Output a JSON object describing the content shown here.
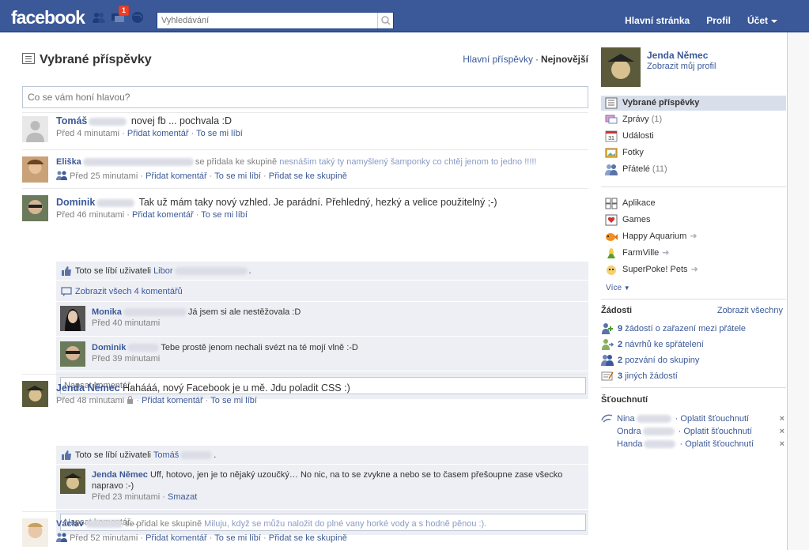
{
  "topbar": {
    "logo": "facebook",
    "notification_count": "1",
    "search_placeholder": "Vyhledávání",
    "nav": [
      "Hlavní stránka",
      "Profil",
      "Účet"
    ]
  },
  "header": {
    "title": "Vybrané příspěvky",
    "sort_top": "Hlavní příspěvky",
    "sort_recent": "Nejnovější"
  },
  "composer": {
    "placeholder": "Co se vám honí hlavou?"
  },
  "stories": [
    {
      "actor": "Tomáš",
      "text": "novej fb ... pochvala :D",
      "time": "Před 4 minutami",
      "comment": "Přidat komentář",
      "like": "To se mi líbí"
    },
    {
      "actor": "Eliška",
      "text": "se přidala ke skupině",
      "group": "nesnášim taký ty namyšlený šamponky co chtěj jenom to jedno !!!!!",
      "time": "Před 25 minutami",
      "comment": "Přidat komentář",
      "like": "To se mi líbí",
      "join": "Přidat se ke skupině"
    },
    {
      "actor": "Dominik",
      "text": "Tak už mám taky nový vzhled. Je parádní. Přehledný, hezký a velice použitelný ;-)",
      "time": "Před 46 minutami",
      "comment": "Přidat komentář",
      "like": "To se mi líbí",
      "likes_prefix": "Toto se líbí uživateli",
      "likes_name": "Libor",
      "likes_suffix": ".",
      "show_all": "Zobrazit všech 4 komentářů",
      "comments": [
        {
          "actor": "Monika",
          "text": "Já jsem si ale nestěžovala :D",
          "time": "Před 40 minutami"
        },
        {
          "actor": "Dominik",
          "text": "Tebe prostě jenom nechali svézt na té mojí vlně :-D",
          "time": "Před 39 minutami"
        }
      ],
      "write_placeholder": "Napsat komentář..."
    },
    {
      "actor": "Jenda Němec",
      "text": "Hahááá, nový Facebook je u mě. Jdu poladit CSS :)",
      "time": "Před 48 minutami",
      "comment": "Přidat komentář",
      "like": "To se mi líbí",
      "likes_prefix": "Toto se líbí uživateli",
      "likes_name": "Tomáš",
      "likes_suffix": ".",
      "comments": [
        {
          "actor": "Jenda Němec",
          "text": "Uff, hotovo, jen je to nějaký uzoučký… No nic, na to se zvykne a nebo se to časem přešoupne zase všecko napravo :-)",
          "time": "Před 23 minutami",
          "delete": "Smazat"
        }
      ],
      "write_placeholder": "Napsat komentář..."
    },
    {
      "actor": "Václav",
      "text": "se přidal ke skupině",
      "group": "Miluju, když se můžu naložit do plné vany horké vody a s hodně pěnou :).",
      "time": "Před 52 minutami",
      "comment": "Přidat komentář",
      "like": "To se mi líbí",
      "join": "Přidat se ke skupině"
    }
  ],
  "sidebar": {
    "name": "Jenda Němec",
    "profile_link": "Zobrazit můj profil",
    "nav": [
      {
        "label": "Vybrané příspěvky",
        "count": "",
        "icon": "news-feed-icon"
      },
      {
        "label": "Zprávy",
        "count": "(1)",
        "icon": "messages-icon"
      },
      {
        "label": "Události",
        "count": "",
        "icon": "events-icon",
        "day": "31"
      },
      {
        "label": "Fotky",
        "count": "",
        "icon": "photos-icon"
      },
      {
        "label": "Přátelé",
        "count": "(11)",
        "icon": "friends-icon"
      }
    ],
    "apps": [
      {
        "label": "Aplikace",
        "arrow": false
      },
      {
        "label": "Games",
        "arrow": false
      },
      {
        "label": "Happy Aquarium",
        "arrow": true
      },
      {
        "label": "FarmVille",
        "arrow": true
      },
      {
        "label": "SuperPoke! Pets",
        "arrow": true
      }
    ],
    "more": "Více",
    "requests_title": "Žádosti",
    "requests_all": "Zobrazit všechny",
    "requests": [
      {
        "count": "9",
        "label": "žádostí o zařazení mezi přátele"
      },
      {
        "count": "2",
        "label": "návrhů ke spřátelení"
      },
      {
        "count": "2",
        "label": "pozvání do skupiny"
      },
      {
        "count": "3",
        "label": "jiných žádostí"
      }
    ],
    "pokes_title": "Šťouchnutí",
    "pokes": [
      {
        "name": "Nina",
        "action": "Oplatit šťouchnutí"
      },
      {
        "name": "Ondra",
        "action": "Oplatit šťouchnutí"
      },
      {
        "name": "Handa",
        "action": "Oplatit šťouchnutí"
      }
    ],
    "close_glyph": "×"
  }
}
